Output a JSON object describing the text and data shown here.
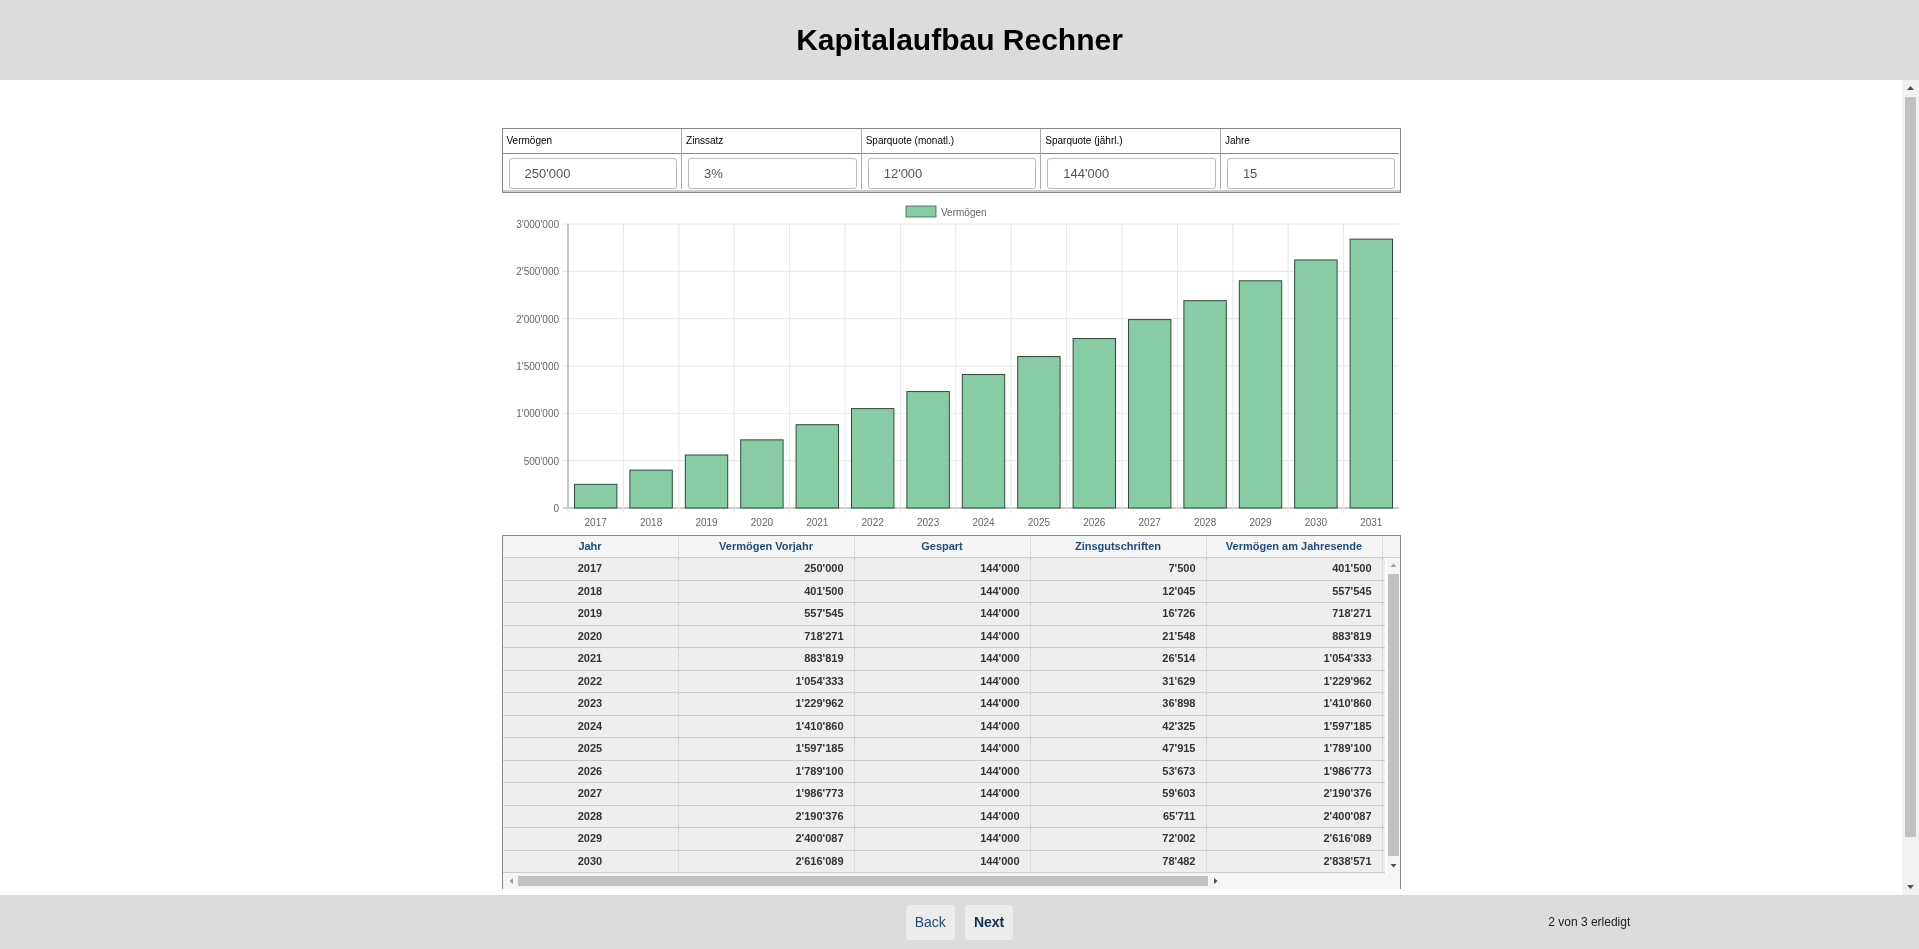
{
  "title": "Kapitalaufbau Rechner",
  "inputs": [
    {
      "label": "Vermögen",
      "value": "250'000"
    },
    {
      "label": "Zinssatz",
      "value": "3%"
    },
    {
      "label": "Sparquote (monatl.)",
      "value": "12'000"
    },
    {
      "label": "Sparquote (jährl.)",
      "value": "144'000"
    },
    {
      "label": "Jahre",
      "value": "15"
    }
  ],
  "chart_data": {
    "type": "bar",
    "categories": [
      "2017",
      "2018",
      "2019",
      "2020",
      "2021",
      "2022",
      "2023",
      "2024",
      "2025",
      "2026",
      "2027",
      "2028",
      "2029",
      "2030",
      "2031"
    ],
    "series": [
      {
        "name": "Vermögen",
        "color": "#88cca6",
        "values": [
          250000,
          400000,
          560000,
          720000,
          880000,
          1050000,
          1230000,
          1410000,
          1600000,
          1790000,
          1990000,
          2190000,
          2400000,
          2620000,
          2840000
        ]
      }
    ],
    "grid": true,
    "ylim": [
      0,
      3000000
    ],
    "yticks": [
      {
        "value": 0,
        "label": "0"
      },
      {
        "value": 500000,
        "label": "500'000"
      },
      {
        "value": 1000000,
        "label": "1'000'000"
      },
      {
        "value": 1500000,
        "label": "1'500'000"
      },
      {
        "value": 2000000,
        "label": "2'000'000"
      },
      {
        "value": 2500000,
        "label": "2'500'000"
      },
      {
        "value": 3000000,
        "label": "3'000'000"
      }
    ]
  },
  "table": {
    "columns": [
      "Jahr",
      "Vermögen Vorjahr",
      "Gespart",
      "Zinsgutschriften",
      "Vermögen am Jahresende"
    ],
    "rows": [
      [
        "2017",
        "250'000",
        "144'000",
        "7'500",
        "401'500"
      ],
      [
        "2018",
        "401'500",
        "144'000",
        "12'045",
        "557'545"
      ],
      [
        "2019",
        "557'545",
        "144'000",
        "16'726",
        "718'271"
      ],
      [
        "2020",
        "718'271",
        "144'000",
        "21'548",
        "883'819"
      ],
      [
        "2021",
        "883'819",
        "144'000",
        "26'514",
        "1'054'333"
      ],
      [
        "2022",
        "1'054'333",
        "144'000",
        "31'629",
        "1'229'962"
      ],
      [
        "2023",
        "1'229'962",
        "144'000",
        "36'898",
        "1'410'860"
      ],
      [
        "2024",
        "1'410'860",
        "144'000",
        "42'325",
        "1'597'185"
      ],
      [
        "2025",
        "1'597'185",
        "144'000",
        "47'915",
        "1'789'100"
      ],
      [
        "2026",
        "1'789'100",
        "144'000",
        "53'673",
        "1'986'773"
      ],
      [
        "2027",
        "1'986'773",
        "144'000",
        "59'603",
        "2'190'376"
      ],
      [
        "2028",
        "2'190'376",
        "144'000",
        "65'711",
        "2'400'087"
      ],
      [
        "2029",
        "2'400'087",
        "144'000",
        "72'002",
        "2'616'089"
      ],
      [
        "2030",
        "2'616'089",
        "144'000",
        "78'482",
        "2'838'571"
      ]
    ]
  },
  "buttons": [
    {
      "label": "Back",
      "emphasized": false
    },
    {
      "label": "Next",
      "emphasized": true
    }
  ],
  "status": "2 von 3 erledigt"
}
